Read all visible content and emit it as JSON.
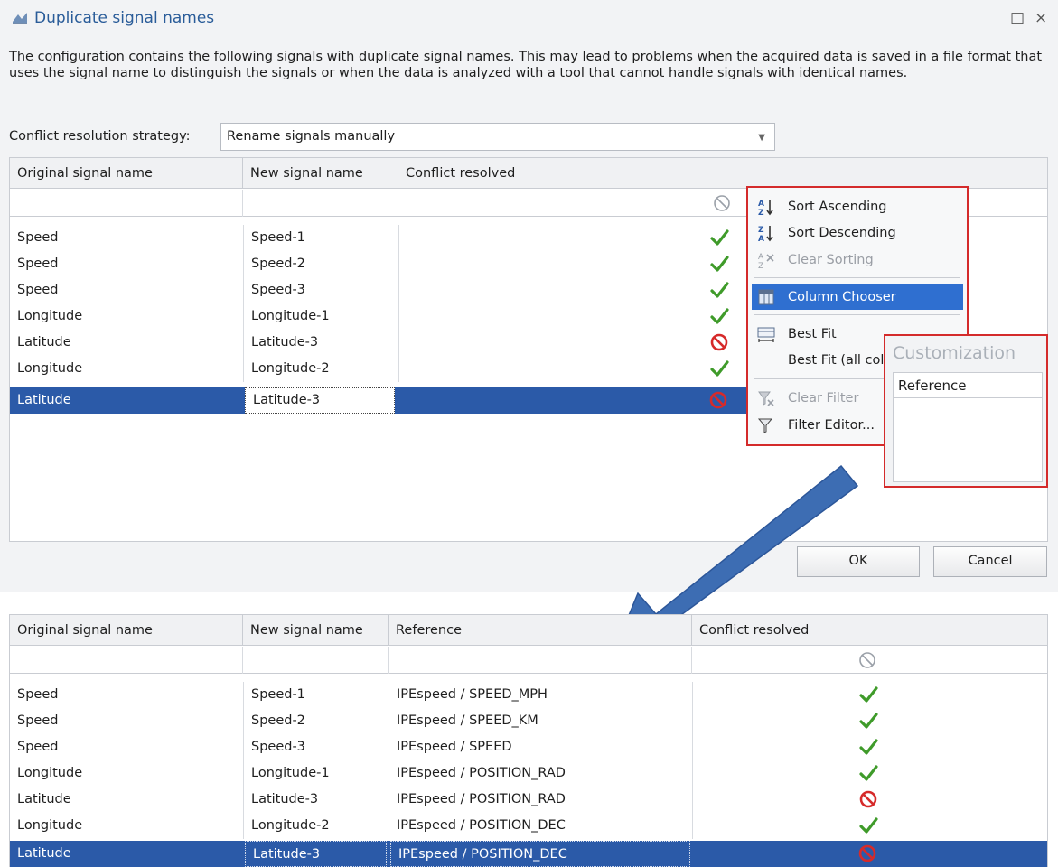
{
  "dialog": {
    "title": "Duplicate signal names",
    "maximize_glyph": "□",
    "close_glyph": "×",
    "description": "The configuration contains the following signals with duplicate signal names. This may lead to problems when the acquired data is saved in a file format that uses the signal name to distinguish the signals or when the data is analyzed with a tool that cannot handle signals with identical names.",
    "strategy_label": "Conflict resolution strategy:",
    "strategy_value": "Rename signals manually",
    "ok_label": "OK",
    "cancel_label": "Cancel"
  },
  "grid1": {
    "columns": [
      "Original signal name",
      "New signal name",
      "Conflict resolved"
    ],
    "rows": [
      {
        "original": "Speed",
        "new": "Speed-1",
        "resolved": "check"
      },
      {
        "original": "Speed",
        "new": "Speed-2",
        "resolved": "check"
      },
      {
        "original": "Speed",
        "new": "Speed-3",
        "resolved": "check"
      },
      {
        "original": "Longitude",
        "new": "Longitude-1",
        "resolved": "check"
      },
      {
        "original": "Latitude",
        "new": "Latitude-3",
        "resolved": "no"
      },
      {
        "original": "Longitude",
        "new": "Longitude-2",
        "resolved": "check"
      },
      {
        "original": "Latitude",
        "new": "Latitude-3",
        "resolved": "no",
        "selected": true
      }
    ]
  },
  "context_menu": {
    "items": [
      {
        "label": "Sort Ascending",
        "icon": "sort-ascending-icon"
      },
      {
        "label": "Sort Descending",
        "icon": "sort-descending-icon"
      },
      {
        "label": "Clear Sorting",
        "icon": "clear-sorting-icon",
        "disabled": true
      },
      {
        "label": "Column Chooser",
        "icon": "column-chooser-icon",
        "highlighted": true
      },
      {
        "label": "Best Fit",
        "icon": "best-fit-icon"
      },
      {
        "label": "Best Fit (all col",
        "icon": ""
      },
      {
        "label": "Clear Filter",
        "icon": "clear-filter-icon",
        "disabled": true
      },
      {
        "label": "Filter Editor...",
        "icon": "filter-editor-icon"
      }
    ]
  },
  "customization": {
    "title": "Customization",
    "items": [
      "Reference"
    ]
  },
  "grid2": {
    "columns": [
      "Original signal name",
      "New signal name",
      "Reference",
      "Conflict resolved"
    ],
    "rows": [
      {
        "original": "Speed",
        "new": "Speed-1",
        "reference": "IPEspeed / SPEED_MPH",
        "resolved": "check"
      },
      {
        "original": "Speed",
        "new": "Speed-2",
        "reference": "IPEspeed / SPEED_KM",
        "resolved": "check"
      },
      {
        "original": "Speed",
        "new": "Speed-3",
        "reference": "IPEspeed / SPEED",
        "resolved": "check"
      },
      {
        "original": "Longitude",
        "new": "Longitude-1",
        "reference": "IPEspeed / POSITION_RAD",
        "resolved": "check"
      },
      {
        "original": "Latitude",
        "new": "Latitude-3",
        "reference": "IPEspeed / POSITION_RAD",
        "resolved": "no"
      },
      {
        "original": "Longitude",
        "new": "Longitude-2",
        "reference": "IPEspeed / POSITION_DEC",
        "resolved": "check"
      },
      {
        "original": "Latitude",
        "new": "Latitude-3",
        "reference": "IPEspeed / POSITION_DEC",
        "resolved": "no",
        "selected": true
      }
    ]
  },
  "colors": {
    "selection": "#2b5aa8",
    "check": "#3f9b2a",
    "no": "#d62a2a",
    "highlight_box": "#d42b2b",
    "arrow": "#3d6db3"
  }
}
